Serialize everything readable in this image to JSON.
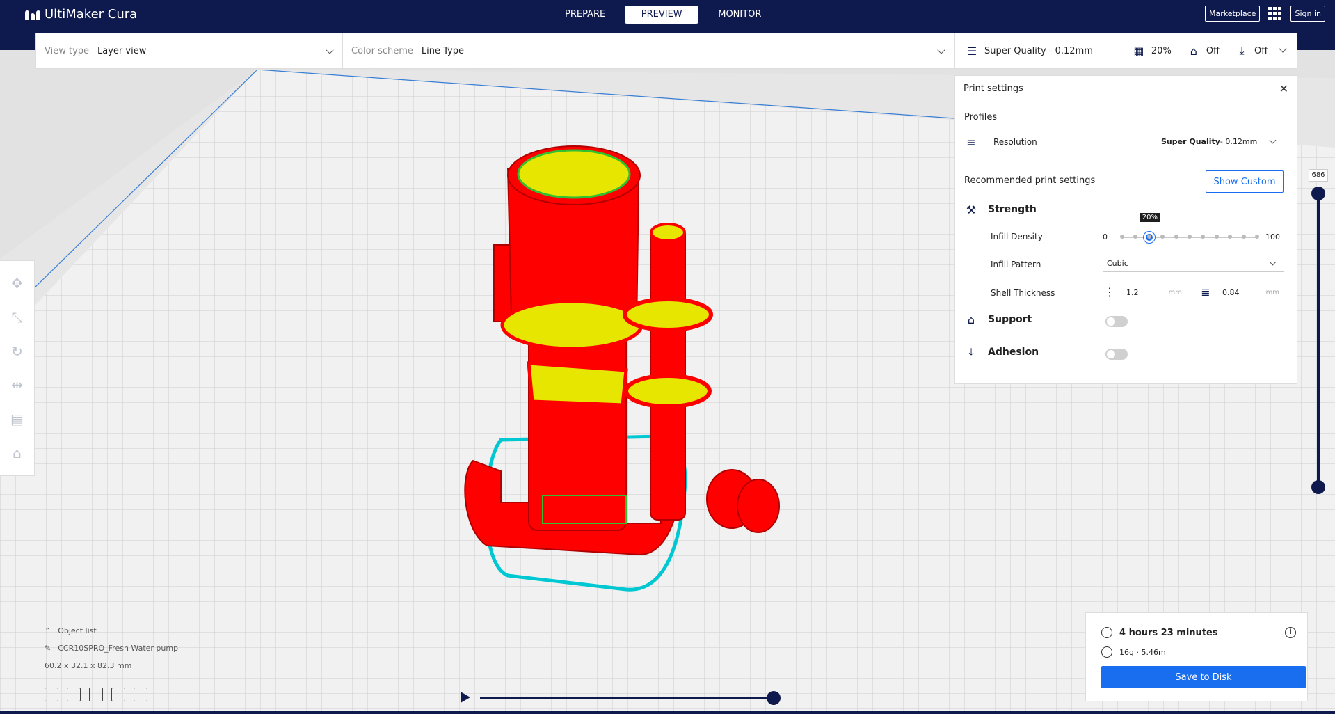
{
  "app": {
    "title": "UltiMaker Cura"
  },
  "nav": {
    "tabs": [
      {
        "label": "PREPARE"
      },
      {
        "label": "PREVIEW"
      },
      {
        "label": "MONITOR"
      }
    ],
    "active": "PREVIEW"
  },
  "top_right": {
    "marketplace": "Marketplace",
    "signin": "Sign in",
    "apps_icon": "apps-grid-icon"
  },
  "view_bar": {
    "view_type_label": "View type",
    "view_type_value": "Layer view",
    "color_scheme_label": "Color scheme",
    "color_scheme_value": "Line Type"
  },
  "quality_bar": {
    "profile": "Super Quality - 0.12mm",
    "infill": "20%",
    "support": "Off",
    "adhesion": "Off"
  },
  "print_settings": {
    "title": "Print settings",
    "profiles_label": "Profiles",
    "resolution_label": "Resolution",
    "resolution_value_bold": "Super Quality",
    "resolution_value_rest": " - 0.12mm",
    "recommended_label": "Recommended print settings",
    "show_custom": "Show Custom",
    "strength_label": "Strength",
    "infill_density_label": "Infill Density",
    "infill_min": "0",
    "infill_max": "100",
    "infill_value": "20%",
    "infill_fraction": 0.2,
    "infill_pattern_label": "Infill Pattern",
    "infill_pattern_value": "Cubic",
    "shell_thickness_label": "Shell Thickness",
    "wall_thickness": "1.2",
    "top_bottom_thickness": "0.84",
    "unit": "mm",
    "support_label": "Support",
    "adhesion_label": "Adhesion",
    "support_on": false,
    "adhesion_on": false
  },
  "layer": {
    "current": "686"
  },
  "object_list": {
    "header": "Object list",
    "name": "CCR10SPRO_Fresh Water pump",
    "dimensions": "60.2 x 32.1 x 82.3 mm"
  },
  "estimate": {
    "time": "4 hours 23 minutes",
    "material": "16g · 5.46m",
    "save": "Save to Disk"
  },
  "colors": {
    "brand_navy": "#0e1a4d",
    "accent_blue": "#196ef0",
    "model_red": "#ff0000",
    "infill_yellow": "#e6e600",
    "skirt_cyan": "#00c8d2"
  }
}
